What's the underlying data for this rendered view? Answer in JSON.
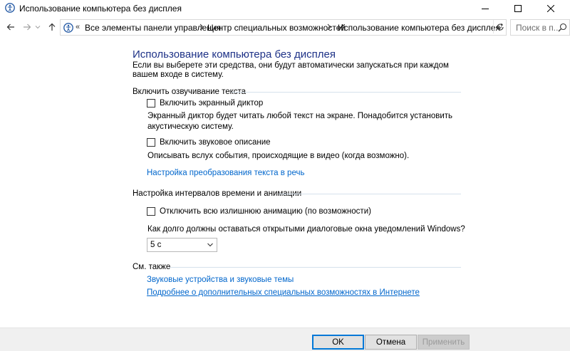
{
  "window": {
    "title": "Использование компьютера без дисплея"
  },
  "address_bar": {
    "breadcrumbs": [
      "Все элементы панели управления",
      "Центр специальных возможностей",
      "Использование компьютера без дисплея"
    ],
    "prefix": "«",
    "search_placeholder": "Поиск в п..."
  },
  "main": {
    "title": "Использование компьютера без дисплея",
    "intro": "Если вы выберете эти средства, они будут автоматически запускаться при каждом вашем входе в систему.",
    "section_speech": {
      "heading": "Включить озвучивание текста",
      "narrator": {
        "label": "Включить экранный диктор",
        "checked": false,
        "description": "Экранный диктор будет читать любой текст на экране. Понадобится установить акустическую систему."
      },
      "audio_description": {
        "label": "Включить звуковое описание",
        "checked": false,
        "description": "Описывать вслух события, происходящие в видео (когда возможно)."
      },
      "tts_link": "Настройка преобразования текста в речь"
    },
    "section_timing": {
      "heading": "Настройка интервалов времени и анимации",
      "animations": {
        "label": "Отключить всю излишнюю анимацию (по возможности)",
        "checked": false
      },
      "notification_question": "Как долго должны оставаться открытыми диалоговые окна уведомлений Windows?",
      "notification_value": "5 с"
    },
    "see_also": {
      "heading": "См. также",
      "links": [
        "Звуковые устройства и звуковые темы",
        "Подробнее о дополнительных специальных возможностях в Интернете"
      ]
    }
  },
  "footer": {
    "ok": "OK",
    "cancel": "Отмена",
    "apply": "Применить"
  },
  "colors": {
    "title_blue": "#1e3287",
    "link_blue": "#0066cc",
    "accent": "#0078d7"
  }
}
